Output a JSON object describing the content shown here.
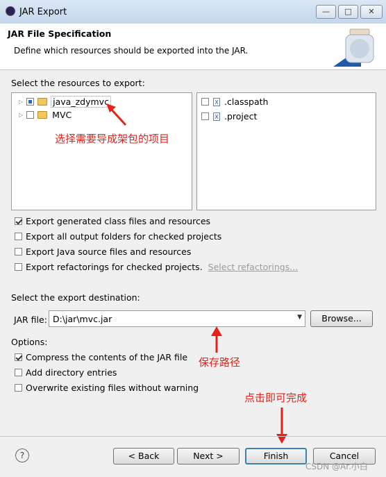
{
  "window": {
    "title": "JAR Export",
    "minimize": "—",
    "maximize": "□",
    "close": "✕"
  },
  "header": {
    "title": "JAR File Specification",
    "description": "Define which resources should be exported into the JAR."
  },
  "resources": {
    "label": "Select the resources to export:",
    "projects": [
      {
        "name": "java_zdymvc",
        "state": "partial"
      },
      {
        "name": "MVC",
        "state": "unchecked"
      }
    ],
    "files": [
      {
        "name": ".classpath",
        "checked": false
      },
      {
        "name": ".project",
        "checked": false
      }
    ]
  },
  "export_options": {
    "generated": "Export generated class files and resources",
    "output_folders": "Export all output folders for checked projects",
    "java_source": "Export Java source files and resources",
    "refactorings": "Export refactorings for checked projects.",
    "select_refactorings": "Select refactorings..."
  },
  "destination": {
    "label": "Select the export destination:",
    "jar_file_label": "JAR file:",
    "jar_file_value": "D:\\jar\\mvc.jar",
    "browse": "Browse..."
  },
  "options": {
    "label": "Options:",
    "compress": "Compress the contents of the JAR file",
    "directory_entries": "Add directory entries",
    "overwrite": "Overwrite existing files without warning"
  },
  "annotations": {
    "select_project": "选择需要导成架包的项目",
    "save_path": "保存路径",
    "click_finish": "点击即可完成"
  },
  "buttons": {
    "back": "< Back",
    "next": "Next >",
    "finish": "Finish",
    "cancel": "Cancel",
    "help": "?"
  },
  "watermark": "CSDN @Ar.小白"
}
